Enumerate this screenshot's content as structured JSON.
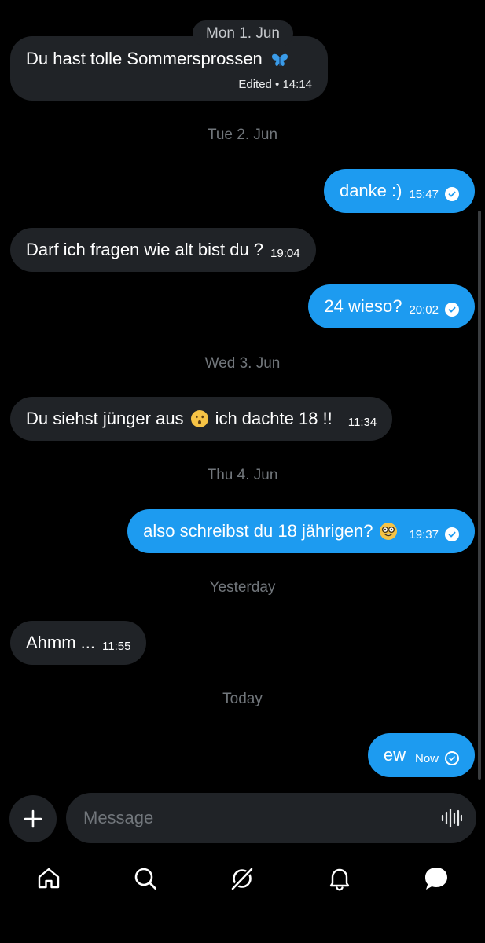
{
  "sticky_date": "Mon 1. Jun",
  "dates": {
    "tue": "Tue 2. Jun",
    "wed": "Wed 3. Jun",
    "thu": "Thu 4. Jun",
    "yesterday": "Yesterday",
    "today": "Today"
  },
  "messages": [
    {
      "text": "Du hast tolle Sommersprossen",
      "emoji": "butterfly-emoji",
      "meta": "Edited • 14:14",
      "direction": "incoming"
    },
    {
      "text": "danke :)",
      "time": "15:47",
      "direction": "outgoing",
      "status": "read"
    },
    {
      "text": "Darf ich fragen wie alt bist du ?",
      "time": "19:04",
      "direction": "incoming"
    },
    {
      "text": "24 wieso?",
      "time": "20:02",
      "direction": "outgoing",
      "status": "read"
    },
    {
      "text_before": "Du siehst jünger aus",
      "emoji": "hushed-face-emoji",
      "text_after": "ich dachte 18 !!",
      "time": "11:34",
      "direction": "incoming"
    },
    {
      "text": "also schreibst du 18 jährigen?",
      "emoji": "nerd-face-emoji",
      "time": "19:37",
      "direction": "outgoing",
      "status": "read"
    },
    {
      "text": "Ahmm ...",
      "time": "11:55",
      "direction": "incoming"
    },
    {
      "text": "ew",
      "time": "Now",
      "direction": "outgoing",
      "status": "sent"
    }
  ],
  "composer": {
    "placeholder": "Message"
  },
  "colors": {
    "accent": "#1d9bf0",
    "incoming_bubble": "#202327",
    "background": "#000000",
    "muted_text": "#71767b"
  },
  "tabbar": [
    "home-icon",
    "search-icon",
    "grok-icon",
    "notifications-icon",
    "messages-icon"
  ]
}
